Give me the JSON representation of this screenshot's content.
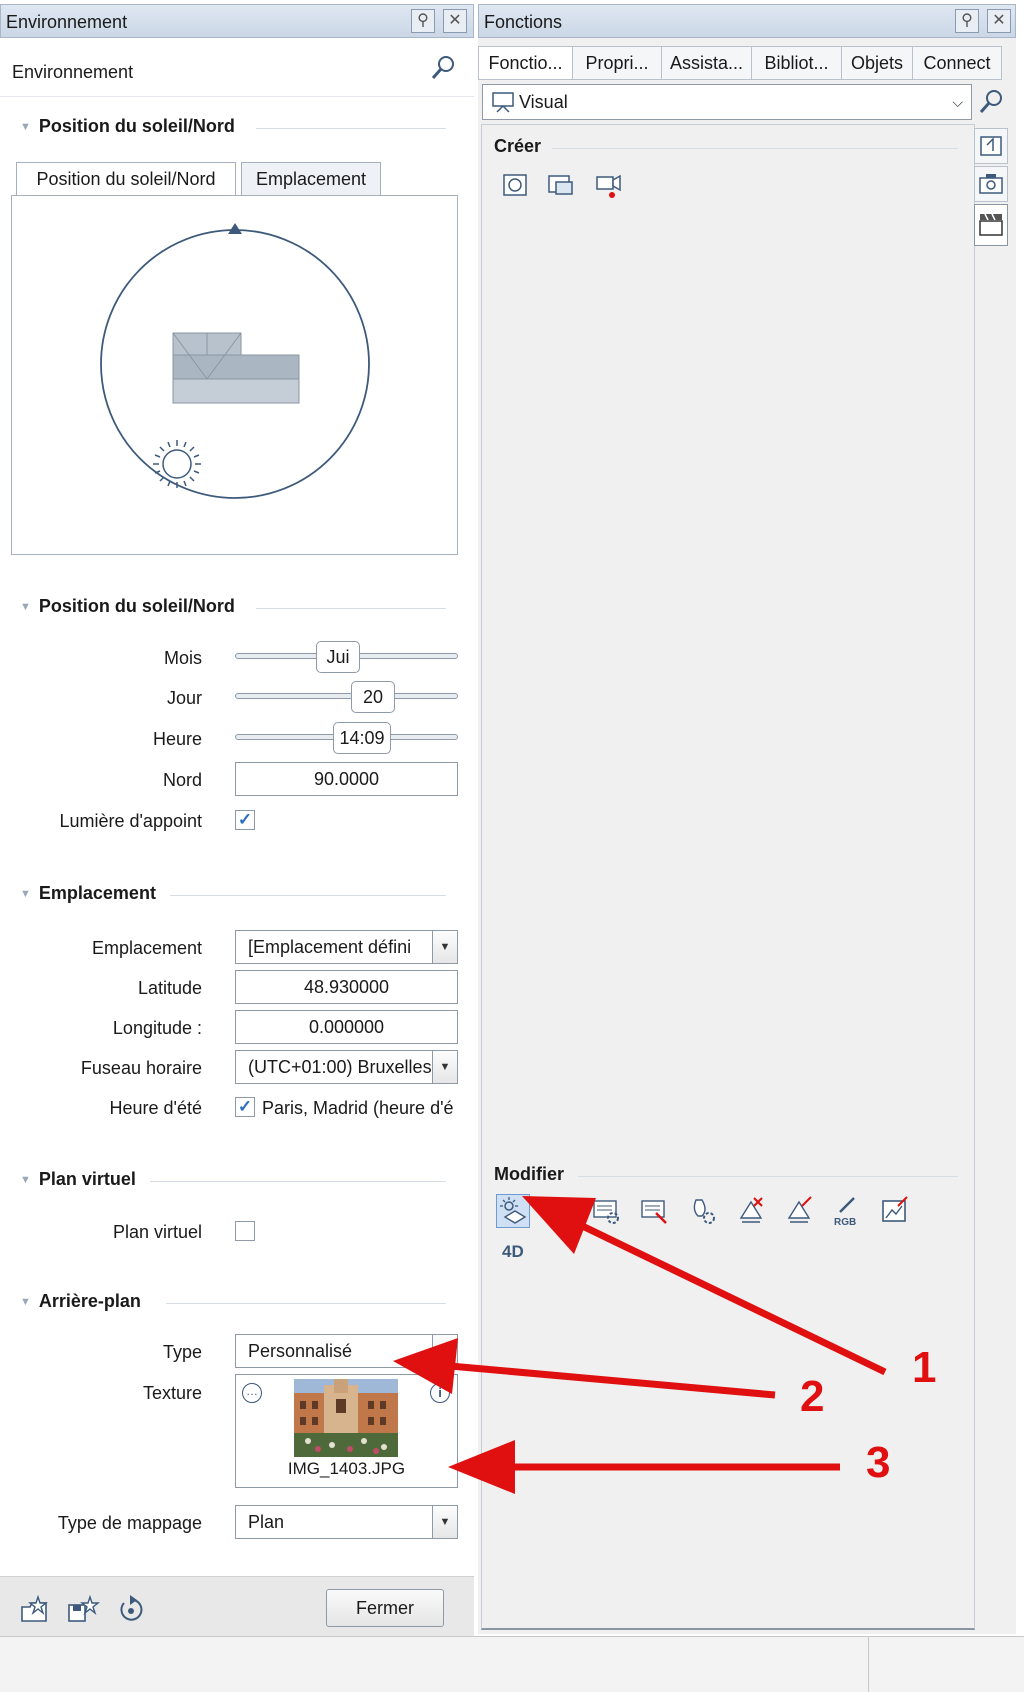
{
  "left_window": {
    "title": "Environnement",
    "search_label": "Environnement",
    "sun_section_title": "Position du soleil/Nord",
    "tabs": [
      "Position du soleil/Nord",
      "Emplacement"
    ],
    "params_section_title": "Position du soleil/Nord",
    "mois": {
      "label": "Mois",
      "value": "Jui"
    },
    "jour": {
      "label": "Jour",
      "value": "20"
    },
    "heure": {
      "label": "Heure",
      "value": "14:09"
    },
    "nord": {
      "label": "Nord",
      "value": "90.0000"
    },
    "lumiere": {
      "label": "Lumière d'appoint",
      "checked": true
    },
    "location_section_title": "Emplacement",
    "emplacement": {
      "label": "Emplacement",
      "value": "[Emplacement défini"
    },
    "latitude": {
      "label": "Latitude",
      "value": "48.930000"
    },
    "longitude": {
      "label": "Longitude :",
      "value": "0.000000"
    },
    "fuseau": {
      "label": "Fuseau horaire",
      "value": "(UTC+01:00) Bruxelles"
    },
    "heure_ete": {
      "label": "Heure d'été",
      "value": "Paris, Madrid (heure d'é",
      "checked": true
    },
    "plan_section_title": "Plan virtuel",
    "plan_virtuel": {
      "label": "Plan virtuel",
      "checked": false
    },
    "background_section_title": "Arrière-plan",
    "type": {
      "label": "Type",
      "value": "Personnalisé"
    },
    "texture": {
      "label": "Texture",
      "filename": "IMG_1403.JPG"
    },
    "mapping": {
      "label": "Type de mappage",
      "value": "Plan"
    },
    "close_label": "Fermer"
  },
  "right_window": {
    "title": "Fonctions",
    "tabs": [
      "Fonctio...",
      "Propri...",
      "Assista...",
      "Bibliot...",
      "Objets",
      "Connect"
    ],
    "selector_value": "Visual",
    "create_section": "Créer",
    "modify_section": "Modifier",
    "label_4d": "4D"
  },
  "annotations": [
    "1",
    "2",
    "3"
  ],
  "colors": {
    "arrow": "#e01010",
    "accent": "#2a6fc0"
  }
}
